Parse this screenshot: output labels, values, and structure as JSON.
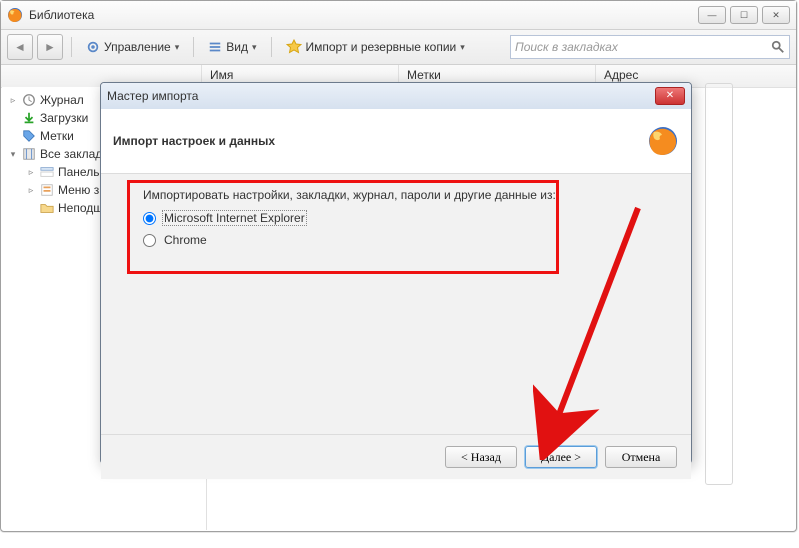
{
  "main_window": {
    "title": "Библиотека",
    "toolbar": {
      "manage": "Управление",
      "view": "Вид",
      "import": "Импорт и резервные копии"
    },
    "search_placeholder": "Поиск в закладках",
    "columns": {
      "name": "Имя",
      "tags": "Метки",
      "address": "Адрес"
    },
    "tree": {
      "journal": "Журнал",
      "downloads": "Загрузки",
      "tags": "Метки",
      "all_bookmarks": "Все закладки",
      "toolbar_panel": "Панель",
      "bookmarks_menu": "Меню з",
      "unsorted": "Неподш"
    }
  },
  "dialog": {
    "title": "Мастер импорта",
    "heading": "Импорт настроек и данных",
    "question": "Импортировать настройки, закладки, журнал, пароли и другие данные из:",
    "options": {
      "ie": "Microsoft Internet Explorer",
      "chrome": "Chrome"
    },
    "buttons": {
      "back": "< Назад",
      "next": "Далее >",
      "cancel": "Отмена"
    }
  },
  "colors": {
    "accent_red": "#e11111"
  }
}
